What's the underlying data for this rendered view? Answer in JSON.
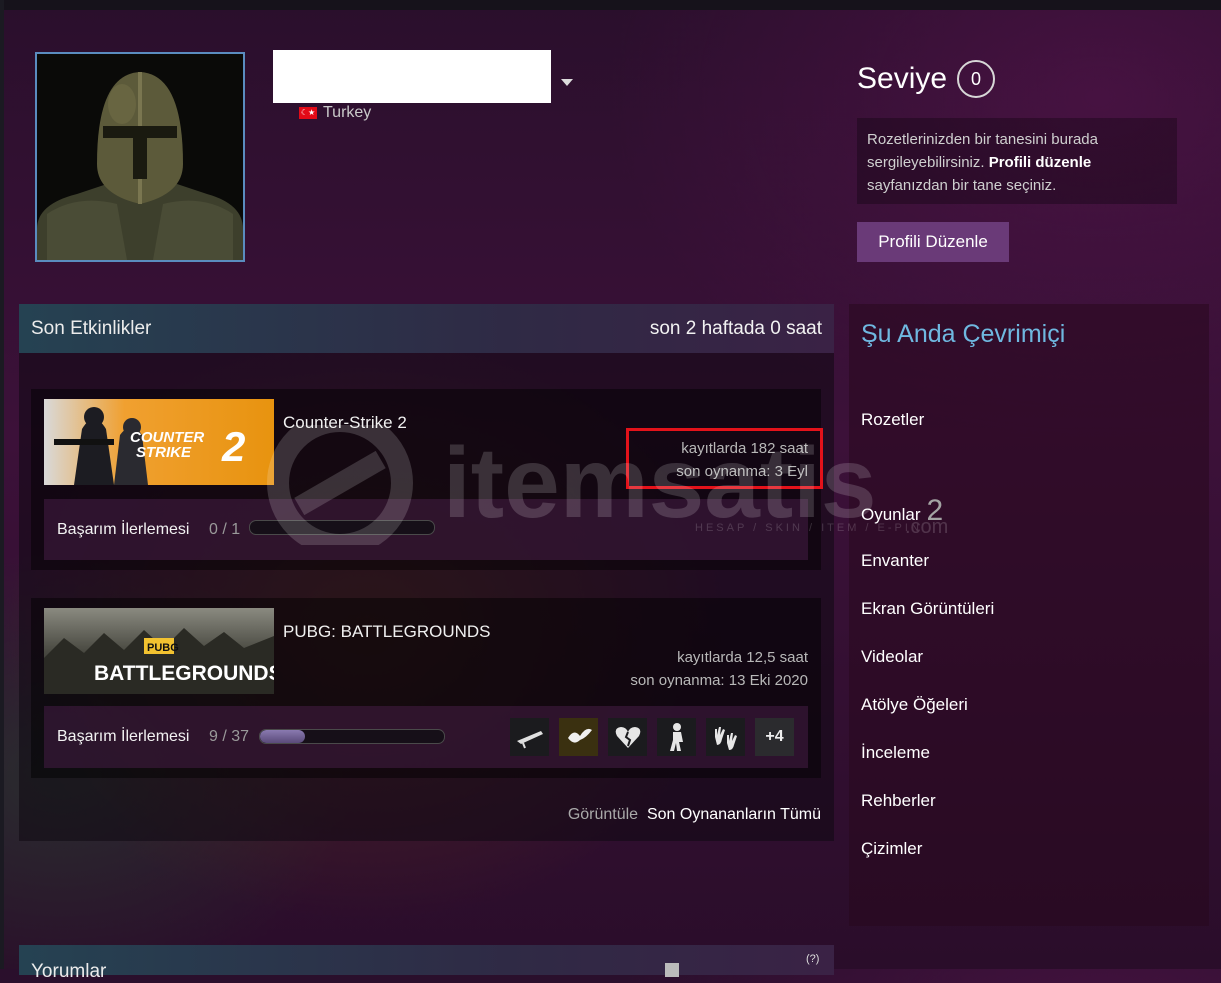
{
  "profile": {
    "country": "Turkey",
    "flag_text": "☾★"
  },
  "level": {
    "title": "Seviye",
    "value": "0"
  },
  "badge_info": {
    "text_before": "Rozetlerinizden bir tanesini burada sergileyebilirsiniz. ",
    "bold": "Profili düzenle",
    "text_after": " sayfanızdan bir tane seçiniz."
  },
  "edit_button": "Profili Düzenle",
  "activity": {
    "title": "Son Etkinlikler",
    "hours": "son 2 haftada 0 saat",
    "games": [
      {
        "name": "Counter-Strike 2",
        "hours": "kayıtlarda 182 saat",
        "last_played": "son oynanma: 3 Eyl",
        "capsule_text_1": "COUNTER",
        "capsule_text_2": "STRIKE",
        "capsule_number": "2",
        "achievement_label": "Başarım İlerlemesi",
        "achievement_count": "0 / 1",
        "progress": 0
      },
      {
        "name": "PUBG: BATTLEGROUNDS",
        "hours": "kayıtlarda 12,5 saat",
        "last_played": "son oynanma: 13 Eki 2020",
        "capsule_text_1": "PUBG",
        "capsule_text_2": "BATTLEGROUNDS",
        "achievement_label": "Başarım İlerlemesi",
        "achievement_count": "9 / 37",
        "progress": 0.243,
        "more_achievements": "+4"
      }
    ],
    "view_prefix": "Görüntüle",
    "view_link": "Son Oynananların Tümü"
  },
  "sidebar": {
    "online_status": "Şu Anda Çevrimiçi",
    "links": {
      "badges": "Rozetler",
      "games": "Oyunlar",
      "games_count": "2",
      "inventory": "Envanter",
      "screenshots": "Ekran Görüntüleri",
      "videos": "Videolar",
      "workshop": "Atölye Öğeleri",
      "reviews": "İnceleme",
      "guides": "Rehberler",
      "artwork": "Çizimler"
    }
  },
  "comments": {
    "title": "Yorumlar",
    "help": "(?)"
  },
  "watermark": {
    "brand": "itemsatis",
    "tagline": "HESAP / SKIN / ITEM / E-PIN",
    "tld": ".com"
  },
  "colors": {
    "accent_online": "#6fb8e0",
    "edit_button": "#6a3a78",
    "highlight_box": "#e3121a"
  }
}
